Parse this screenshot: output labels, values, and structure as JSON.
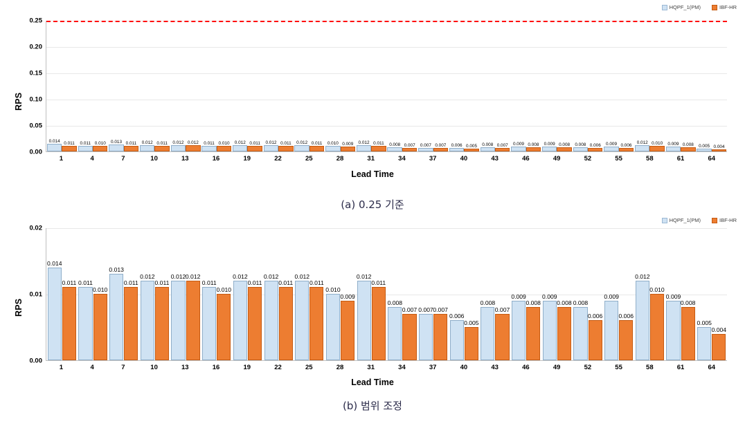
{
  "chart_data": [
    {
      "id": "panel-a",
      "type": "bar",
      "title": "",
      "caption": "(a) 0.25 기준",
      "xlabel": "Lead Time",
      "ylabel": "RPS",
      "ylim": [
        0,
        0.25
      ],
      "yticks": [
        "0.00",
        "0.05",
        "0.10",
        "0.15",
        "0.20",
        "0.25"
      ],
      "ytick_values": [
        0,
        0.05,
        0.1,
        0.15,
        0.2,
        0.25
      ],
      "grid": true,
      "legend_position": "top-right",
      "reference_line": {
        "value": 0.25,
        "color": "#ff0000",
        "style": "dashed"
      },
      "categories": [
        "1",
        "4",
        "7",
        "10",
        "13",
        "16",
        "19",
        "22",
        "25",
        "28",
        "31",
        "34",
        "37",
        "40",
        "43",
        "46",
        "49",
        "52",
        "55",
        "58",
        "61",
        "64"
      ],
      "series": [
        {
          "name": "HQPF_1(PM)",
          "color": "#cfe2f3",
          "values": [
            0.014,
            0.011,
            0.013,
            0.012,
            0.012,
            0.011,
            0.012,
            0.012,
            0.012,
            0.01,
            0.012,
            0.008,
            0.007,
            0.006,
            0.008,
            0.009,
            0.009,
            0.008,
            0.009,
            0.012,
            0.009,
            0.005
          ],
          "labels": [
            "0.014",
            "0.011",
            "0.013",
            "0.012",
            "0.012",
            "0.011",
            "0.012",
            "0.012",
            "0.012",
            "0.010",
            "0.012",
            "0.008",
            "0.007",
            "0.006",
            "0.008",
            "0.009",
            "0.009",
            "0.008",
            "0.009",
            "0.012",
            "0.009",
            "0.005"
          ]
        },
        {
          "name": "IBF-HR",
          "color": "#ed7d31",
          "values": [
            0.011,
            0.01,
            0.011,
            0.011,
            0.012,
            0.01,
            0.011,
            0.011,
            0.011,
            0.009,
            0.011,
            0.007,
            0.007,
            0.005,
            0.007,
            0.008,
            0.008,
            0.006,
            0.006,
            0.01,
            0.008,
            0.004
          ],
          "labels": [
            "0.011",
            "0.010",
            "0.011",
            "0.011",
            "0.012",
            "0.010",
            "0.011",
            "0.011",
            "0.011",
            "0.009",
            "0.011",
            "0.007",
            "0.007",
            "0.005",
            "0.007",
            "0.008",
            "0.008",
            "0.006",
            "0.006",
            "0.010",
            "0.008",
            "0.004"
          ]
        }
      ]
    },
    {
      "id": "panel-b",
      "type": "bar",
      "title": "",
      "caption": "(b) 범위 조정",
      "xlabel": "Lead Time",
      "ylabel": "RPS",
      "ylim": [
        0,
        0.02
      ],
      "yticks": [
        "0.00",
        "0.01",
        "0.02"
      ],
      "ytick_values": [
        0,
        0.01,
        0.02
      ],
      "grid": true,
      "legend_position": "top-right",
      "reference_line": null,
      "categories": [
        "1",
        "4",
        "7",
        "10",
        "13",
        "16",
        "19",
        "22",
        "25",
        "28",
        "31",
        "34",
        "37",
        "40",
        "43",
        "46",
        "49",
        "52",
        "55",
        "58",
        "61",
        "64"
      ],
      "series": [
        {
          "name": "HQPF_1(PM)",
          "color": "#cfe2f3",
          "values": [
            0.014,
            0.011,
            0.013,
            0.012,
            0.012,
            0.011,
            0.012,
            0.012,
            0.012,
            0.01,
            0.012,
            0.008,
            0.007,
            0.006,
            0.008,
            0.009,
            0.009,
            0.008,
            0.009,
            0.012,
            0.009,
            0.005
          ],
          "labels": [
            "0.014",
            "0.011",
            "0.013",
            "0.012",
            "0.012",
            "0.011",
            "0.012",
            "0.012",
            "0.012",
            "0.010",
            "0.012",
            "0.008",
            "0.007",
            "0.006",
            "0.008",
            "0.009",
            "0.009",
            "0.008",
            "0.009",
            "0.012",
            "0.009",
            "0.005"
          ]
        },
        {
          "name": "IBF-HR",
          "color": "#ed7d31",
          "values": [
            0.011,
            0.01,
            0.011,
            0.011,
            0.012,
            0.01,
            0.011,
            0.011,
            0.011,
            0.009,
            0.011,
            0.007,
            0.007,
            0.005,
            0.007,
            0.008,
            0.008,
            0.006,
            0.006,
            0.01,
            0.008,
            0.004
          ],
          "labels": [
            "0.011",
            "0.010",
            "0.011",
            "0.011",
            "0.012",
            "0.010",
            "0.011",
            "0.011",
            "0.011",
            "0.009",
            "0.011",
            "0.007",
            "0.007",
            "0.005",
            "0.007",
            "0.008",
            "0.008",
            "0.006",
            "0.006",
            "0.010",
            "0.008",
            "0.004"
          ]
        }
      ]
    }
  ],
  "legend": {
    "series_1": "HQPF_1(PM)",
    "series_2": "IBF-HR"
  },
  "captions": {
    "a": "(a) 0.25 기준",
    "b": "(b) 범위 조정"
  },
  "axis": {
    "x_title": "Lead Time",
    "y_title": "RPS"
  },
  "colors": {
    "blue": "#cfe2f3",
    "orange": "#ed7d31",
    "reference": "#ff0000",
    "grid": "#e8e8e8"
  }
}
